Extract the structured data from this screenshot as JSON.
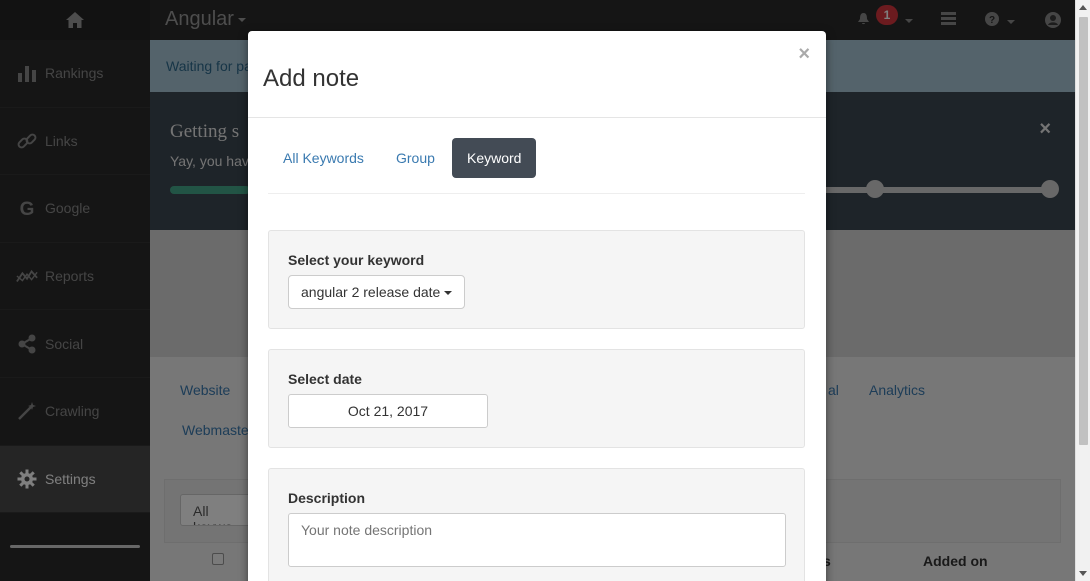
{
  "app": {
    "title": "Angular",
    "notification_count": "1"
  },
  "sidebar": {
    "items": [
      {
        "label": "Rankings",
        "icon": "bar-chart-icon"
      },
      {
        "label": "Links",
        "icon": "link-icon"
      },
      {
        "label": "Google",
        "icon": "google-icon"
      },
      {
        "label": "Reports",
        "icon": "reports-icon"
      },
      {
        "label": "Social",
        "icon": "share-icon"
      },
      {
        "label": "Crawling",
        "icon": "magic-wand-icon"
      },
      {
        "label": "Settings",
        "icon": "gear-icon",
        "active": true
      }
    ]
  },
  "background": {
    "notice_text": "Waiting for pa",
    "getting_title": "Getting s",
    "getting_sub": "Yay, you hav",
    "tabs": [
      "Website",
      "al",
      "Analytics",
      "Webmaste"
    ],
    "filter_select": "All keywo",
    "columns": [
      "s",
      "Added on"
    ]
  },
  "modal": {
    "title": "Add note",
    "close": "×",
    "tabs": [
      {
        "label": "All Keywords",
        "active": false
      },
      {
        "label": "Group",
        "active": false
      },
      {
        "label": "Keyword",
        "active": true
      }
    ],
    "keyword": {
      "label": "Select your keyword",
      "value": "angular 2 release date"
    },
    "date": {
      "label": "Select date",
      "value": "Oct 21, 2017"
    },
    "description": {
      "label": "Description",
      "placeholder": "Your note description"
    }
  },
  "colors": {
    "accent": "#434b55",
    "link": "#3a7ab0",
    "badge": "#d9363e",
    "progress": "#45a98b"
  }
}
